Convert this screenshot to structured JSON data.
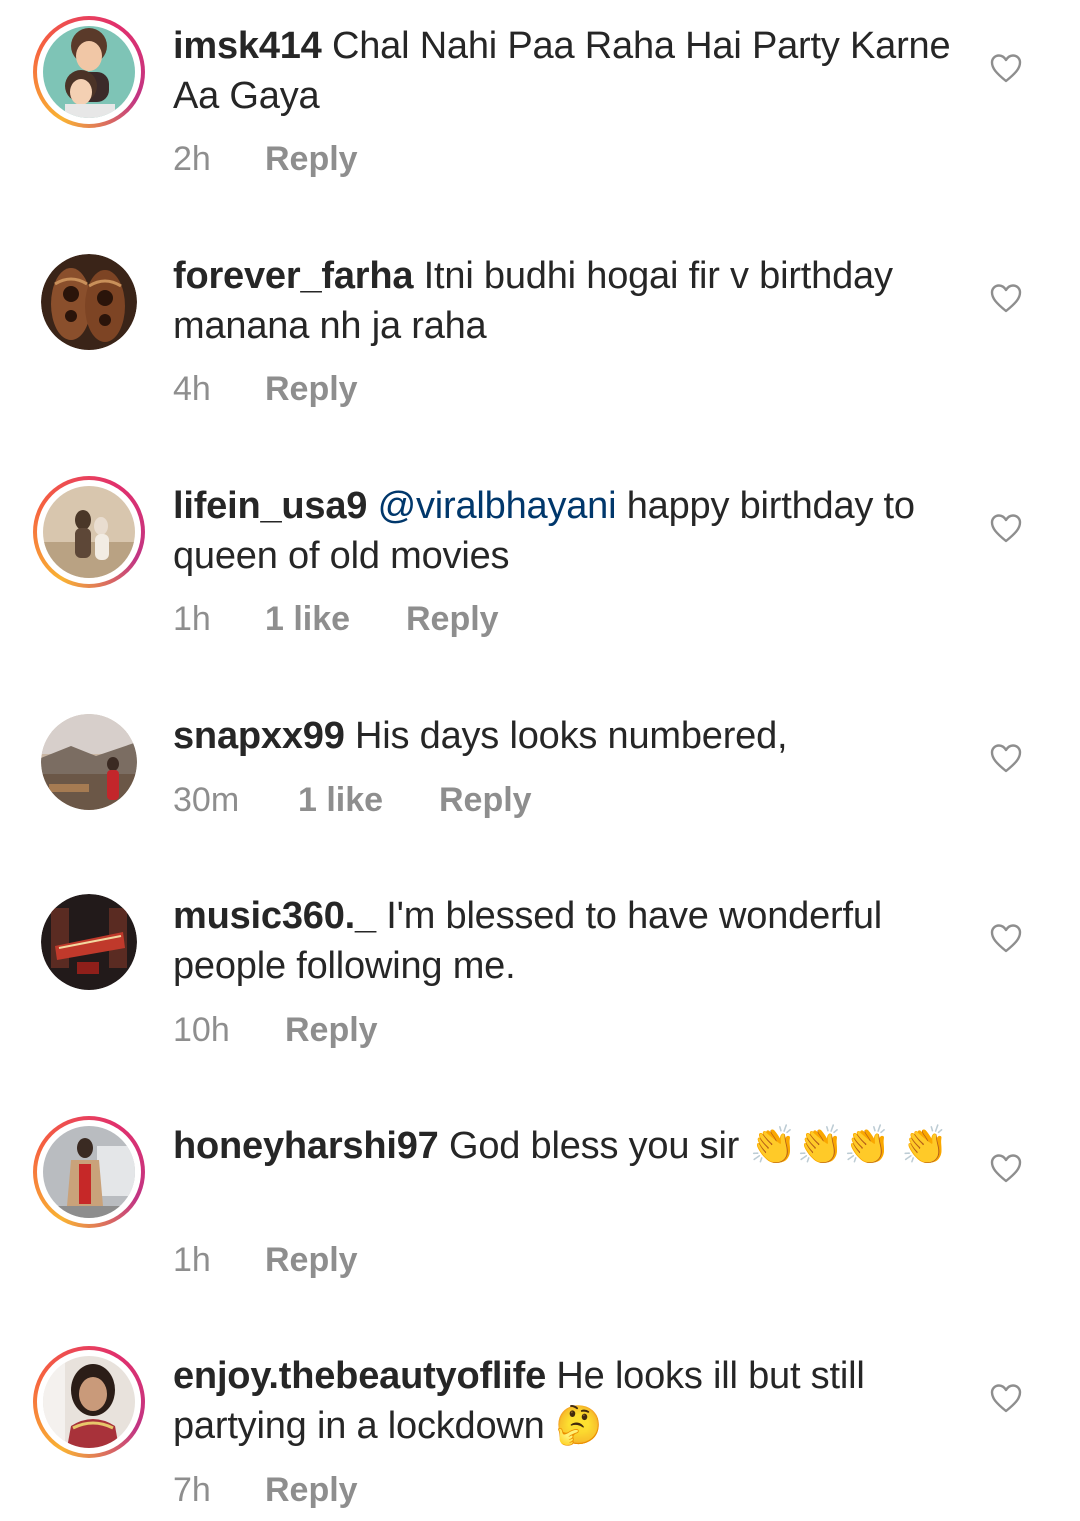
{
  "comments": [
    {
      "username": "imsk414",
      "text": "Chal Nahi Paa Raha Hai Party Karne Aa Gaya",
      "time": "2h",
      "likes": "",
      "reply": "Reply"
    },
    {
      "username": "forever_farha",
      "text": "Itni budhi hogai fir v birthday manana nh ja raha",
      "time": "4h",
      "likes": "",
      "reply": "Reply"
    },
    {
      "username": "lifein_usa9",
      "mention": "@viralbhayani",
      "text": "happy birthday to queen of old movies",
      "time": "1h",
      "likes": "1 like",
      "reply": "Reply"
    },
    {
      "username": "snapxx99",
      "text": "His days looks numbered,",
      "time": "30m",
      "likes": "1 like",
      "reply": "Reply"
    },
    {
      "username": "music360._",
      "text": "I'm blessed to have wonderful people following me.",
      "time": "10h",
      "likes": "",
      "reply": "Reply"
    },
    {
      "username": "honeyharshi97",
      "text": "God bless you sir 👏👏👏 👏",
      "time": "1h",
      "likes": "",
      "reply": "Reply"
    },
    {
      "username": "enjoy.thebeautyoflife",
      "text": "He looks ill but still partying in a lockdown 🤔",
      "time": "7h",
      "likes": "",
      "reply": "Reply"
    }
  ],
  "icons": {
    "like": "heart-outline-icon"
  },
  "colors": {
    "text": "#262626",
    "meta": "#8e8e8e",
    "mention": "#00376b",
    "story_ring": [
      "#f9b233",
      "#f56040",
      "#e1306c",
      "#c13584"
    ]
  }
}
